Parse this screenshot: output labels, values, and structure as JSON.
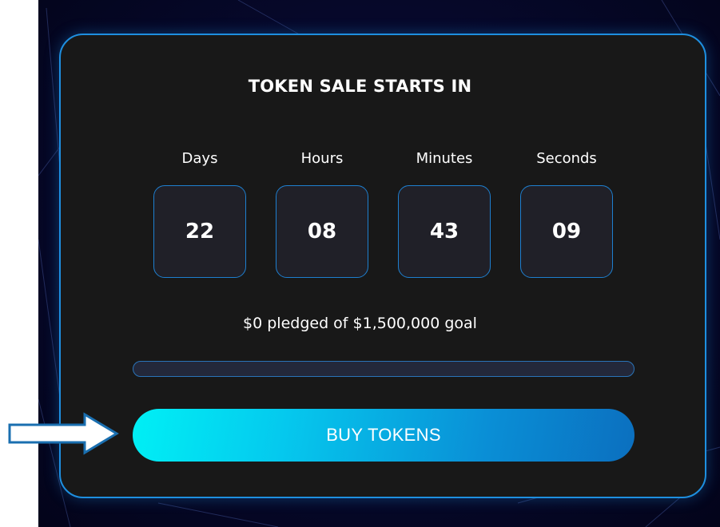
{
  "countdown": {
    "title": "TOKEN SALE STARTS IN",
    "units": [
      {
        "label": "Days",
        "value": "22"
      },
      {
        "label": "Hours",
        "value": "08"
      },
      {
        "label": "Minutes",
        "value": "43"
      },
      {
        "label": "Seconds",
        "value": "09"
      }
    ]
  },
  "pledge": {
    "text": "$0 pledged of $1,500,000 goal",
    "progress_fraction": 0
  },
  "cta": {
    "label": "BUY TOKENS"
  },
  "colors": {
    "accent_border": "#1e8fe0",
    "card_background": "#181818",
    "button_gradient_start": "#00f0f5",
    "button_gradient_end": "#0b6fbf",
    "arrow_stroke": "#1a6fb0"
  },
  "icons": {
    "pointer_arrow": "right-arrow-icon"
  }
}
